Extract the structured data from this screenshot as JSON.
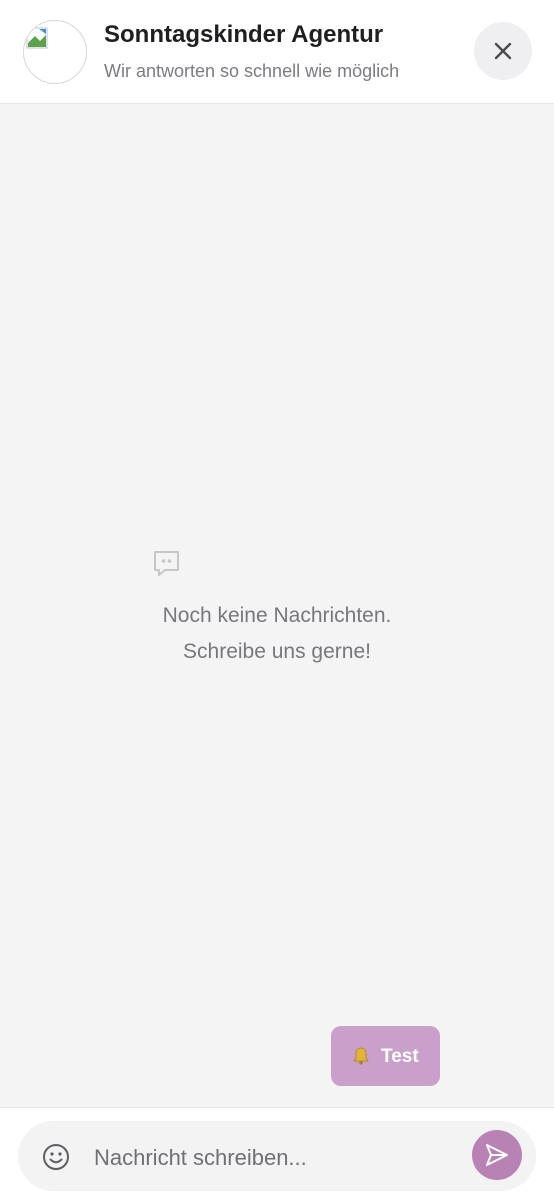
{
  "header": {
    "title": "Sonntagskinder Agentur",
    "subtitle": "Wir antworten so schnell wie möglich",
    "avatar_icon": "broken-image-icon",
    "close_icon": "close-icon"
  },
  "empty_state": {
    "icon": "chat-bubble-icon",
    "line_1": "Noch keine Nachrichten.",
    "line_2": "Schreibe uns gerne!"
  },
  "test_button": {
    "icon": "bell-icon",
    "label": "Test"
  },
  "composer": {
    "emoji_icon": "smiley-icon",
    "placeholder": "Nachricht schreiben...",
    "value": "",
    "send_icon": "send-icon"
  },
  "colors": {
    "accent": "#c9a0c9",
    "send_button": "#b882b5",
    "background": "#f4f4f5"
  }
}
